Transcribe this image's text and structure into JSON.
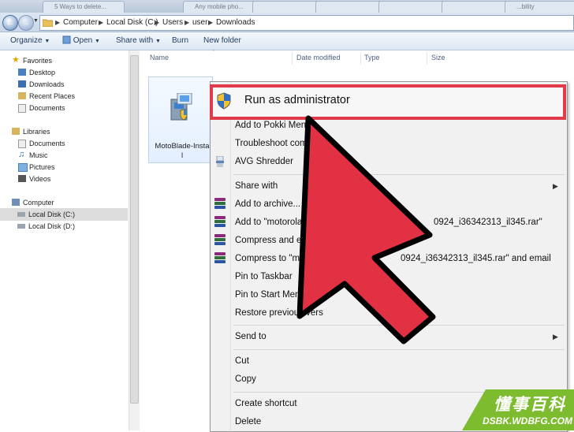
{
  "tabs": [
    "5 Ways to delete...",
    "Any mobile pho...",
    "",
    "",
    "",
    "",
    "...bility"
  ],
  "address": {
    "crumbs": [
      "Computer",
      "Local Disk (C:)",
      "Users",
      "user",
      "Downloads"
    ]
  },
  "toolbar": {
    "organize": "Organize",
    "open": "Open",
    "share_with": "Share with",
    "burn": "Burn",
    "new_folder": "New folder"
  },
  "nav": {
    "favorites": "Favorites",
    "desktop": "Desktop",
    "downloads": "Downloads",
    "recent_places": "Recent Places",
    "documents_fav": "Documents",
    "libraries": "Libraries",
    "documents": "Documents",
    "music": "Music",
    "pictures": "Pictures",
    "videos": "Videos",
    "computer": "Computer",
    "local_c": "Local Disk (C:)",
    "local_d": "Local Disk (D:)"
  },
  "columns": {
    "name": "Name",
    "date_modified": "Date modified",
    "type": "Type",
    "size": "Size"
  },
  "file": {
    "name_line1": "MotoBlade-Insta",
    "name_line2": "l"
  },
  "menu": {
    "run_as_admin": "Run as administrator",
    "add_pokki": "Add to Pokki Menu",
    "troubleshoot": "Troubleshoot comp",
    "avg_shredder": "AVG Shredder",
    "share_with": "Share with",
    "add_archive": "Add to archive...",
    "add_to_rar_start": "Add to \"motorola ps",
    "add_to_rar_end": "0924_i36342313_il345.rar\"",
    "compress_email": "Compress and email",
    "compress_to_start": "Compress to \"motor",
    "compress_to_end": "0924_i36342313_il345.rar\" and email",
    "pin_taskbar": "Pin to Taskbar",
    "pin_start": "Pin to Start Menu",
    "restore_prev": "Restore previous vers",
    "send_to": "Send to",
    "cut": "Cut",
    "copy": "Copy",
    "create_shortcut": "Create shortcut",
    "delete": "Delete"
  },
  "watermark": {
    "cn": "懂事百科",
    "url": "DSBK.WDBFG.COM"
  },
  "colors": {
    "highlight_red": "#e23a4a",
    "arrow_red": "#e13143",
    "watermark_green": "#7dbb2f"
  }
}
